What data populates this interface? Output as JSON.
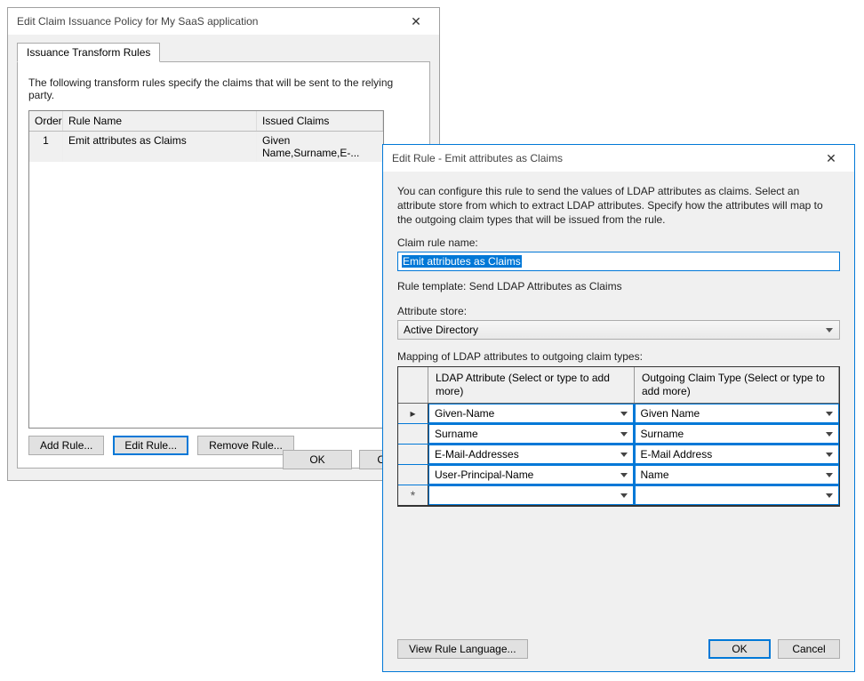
{
  "w1": {
    "title": "Edit Claim Issuance Policy for My SaaS application",
    "tab": "Issuance Transform Rules",
    "desc": "The following transform rules specify the claims that will be sent to the relying party.",
    "cols": {
      "order": "Order",
      "name": "Rule Name",
      "claims": "Issued Claims"
    },
    "rows": [
      {
        "order": "1",
        "name": "Emit attributes as Claims",
        "claims": "Given Name,Surname,E-..."
      }
    ],
    "buttons": {
      "add": "Add Rule...",
      "edit": "Edit Rule...",
      "remove": "Remove Rule...",
      "ok": "OK",
      "cancel": "Cancel"
    }
  },
  "w2": {
    "title": "Edit Rule - Emit attributes as Claims",
    "intro": "You can configure this rule to send the values of LDAP attributes as claims. Select an attribute store from which to extract LDAP attributes. Specify how the attributes will map to the outgoing claim types that will be issued from the rule.",
    "labels": {
      "claimRuleName": "Claim rule name:",
      "ruleTemplate": "Rule template: Send LDAP Attributes as Claims",
      "attrStore": "Attribute store:",
      "mapping": "Mapping of LDAP attributes to outgoing claim types:",
      "colLdap": "LDAP Attribute (Select or type to add more)",
      "colOut": "Outgoing Claim Type (Select or type to add more)"
    },
    "claimRuleName": "Emit attributes as Claims",
    "attrStore": "Active Directory",
    "map": [
      {
        "ldap": "Given-Name",
        "out": "Given Name"
      },
      {
        "ldap": "Surname",
        "out": "Surname"
      },
      {
        "ldap": "E-Mail-Addresses",
        "out": "E-Mail Address"
      },
      {
        "ldap": "User-Principal-Name",
        "out": "Name"
      }
    ],
    "buttons": {
      "viewLang": "View Rule Language...",
      "ok": "OK",
      "cancel": "Cancel"
    }
  }
}
